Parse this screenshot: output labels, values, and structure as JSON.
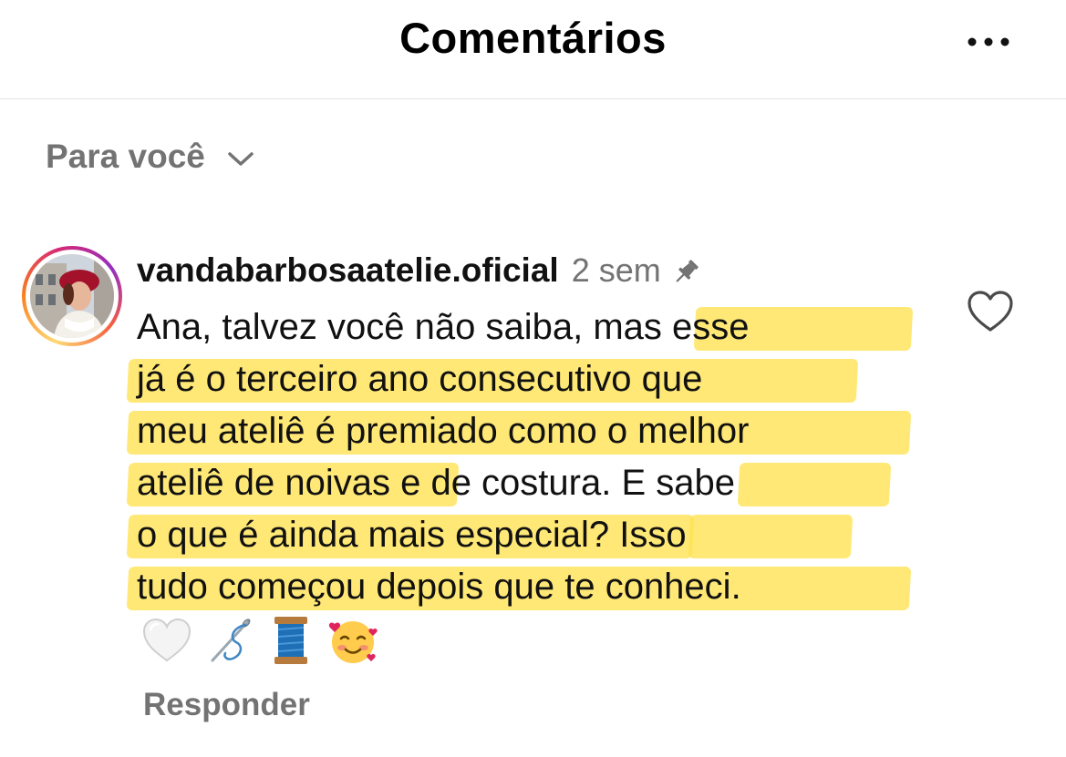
{
  "header": {
    "title": "Comentários",
    "more_icon": "more-horizontal-icon"
  },
  "sort": {
    "label": "Para você",
    "icon": "chevron-down-icon"
  },
  "comment": {
    "username": "vandabarbosaatelie.oficial",
    "time": "2 sem",
    "pinned_icon": "pin-icon",
    "lines": [
      "Ana, talvez você não saiba, mas esse",
      "já é o terceiro ano consecutivo que",
      "meu ateliê é premiado como o melhor",
      "ateliê de noivas e de costura. E sabe",
      "o que é ainda mais especial? Isso",
      "tudo começou depois que te conheci."
    ],
    "emojis": [
      "white-heart-icon",
      "sewing-needle-icon",
      "thread-spool-icon",
      "smiling-face-with-hearts-icon"
    ],
    "reply_label": "Responder",
    "like_icon": "heart-outline-icon"
  },
  "colors": {
    "highlight": "#ffe14f",
    "muted_text": "#737373",
    "text": "#111111"
  }
}
